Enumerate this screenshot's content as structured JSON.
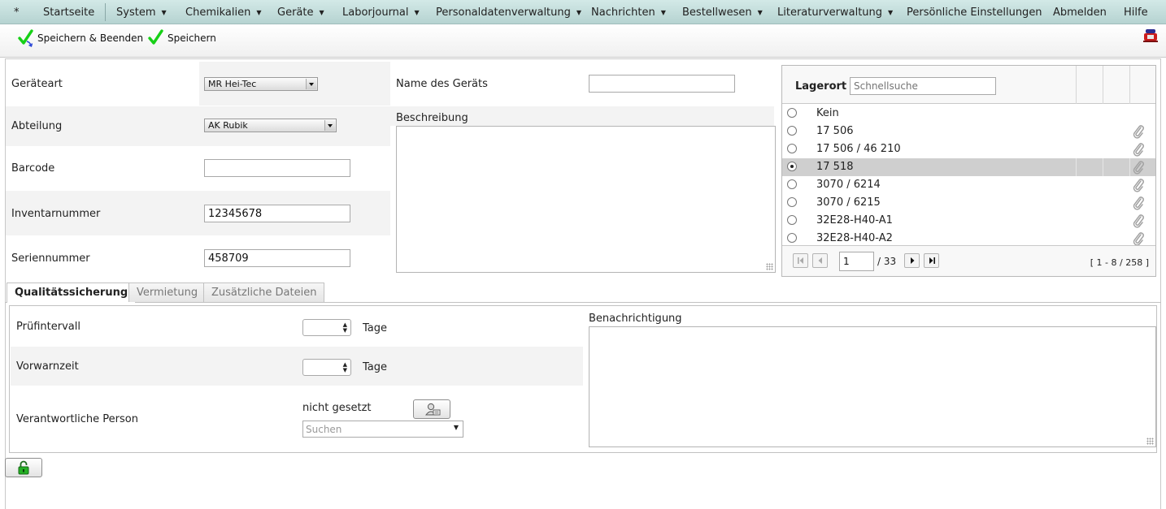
{
  "menu": {
    "star": "*",
    "items": [
      {
        "label": "Startseite"
      },
      {
        "label": "System"
      },
      {
        "label": "Chemikalien"
      },
      {
        "label": "Geräte"
      },
      {
        "label": "Laborjournal"
      },
      {
        "label": "Personaldatenverwaltung"
      },
      {
        "label": "Nachrichten"
      },
      {
        "label": "Bestellwesen"
      },
      {
        "label": "Literaturverwaltung"
      },
      {
        "label": "Persönliche Einstellungen"
      },
      {
        "label": "Abmelden"
      },
      {
        "label": "Hilfe"
      }
    ]
  },
  "toolbar": {
    "save_close_label": "Speichern & Beenden",
    "save_label": "Speichern"
  },
  "form": {
    "geraeteart_label": "Geräteart",
    "geraeteart_value": "MR Hei-Tec",
    "abteilung_label": "Abteilung",
    "abteilung_value": "AK Rubik",
    "barcode_label": "Barcode",
    "barcode_value": "",
    "inventar_label": "Inventarnummer",
    "inventar_value": "12345678",
    "serien_label": "Seriennummer",
    "serien_value": "458709",
    "name_label": "Name des Geräts",
    "name_value": "",
    "beschreibung_label": "Beschreibung"
  },
  "lagerort": {
    "title": "Lagerort",
    "search_placeholder": "Schnellsuche",
    "rows": [
      {
        "text": "Kein",
        "selected": false,
        "clip": false
      },
      {
        "text": "17 506",
        "selected": false,
        "clip": true
      },
      {
        "text": "17 506 / 46 210",
        "selected": false,
        "clip": true
      },
      {
        "text": "17 518",
        "selected": true,
        "clip": true
      },
      {
        "text": "3070 / 6214",
        "selected": false,
        "clip": true
      },
      {
        "text": "3070 / 6215",
        "selected": false,
        "clip": true
      },
      {
        "text": "32E28-H40-A1",
        "selected": false,
        "clip": true
      },
      {
        "text": "32E28-H40-A2",
        "selected": false,
        "clip": true
      }
    ],
    "page_value": "1",
    "page_total": "/ 33",
    "range": "[ 1 - 8 / 258 ]"
  },
  "tabs": [
    {
      "label": "Qualitätssicherung",
      "active": true
    },
    {
      "label": "Vermietung",
      "active": false
    },
    {
      "label": "Zusätzliche Dateien",
      "active": false
    }
  ],
  "qs": {
    "pruef_label": "Prüfintervall",
    "vorwarn_label": "Vorwarnzeit",
    "unit": "Tage",
    "person_label": "Verantwortliche Person",
    "person_value": "nicht gesetzt",
    "search_placeholder": "Suchen",
    "benachrichtigung_label": "Benachrichtigung"
  },
  "colors": {
    "menu_bg": "#c4dedc",
    "check_green": "#17d017",
    "selected_row": "#cfcfcf"
  }
}
